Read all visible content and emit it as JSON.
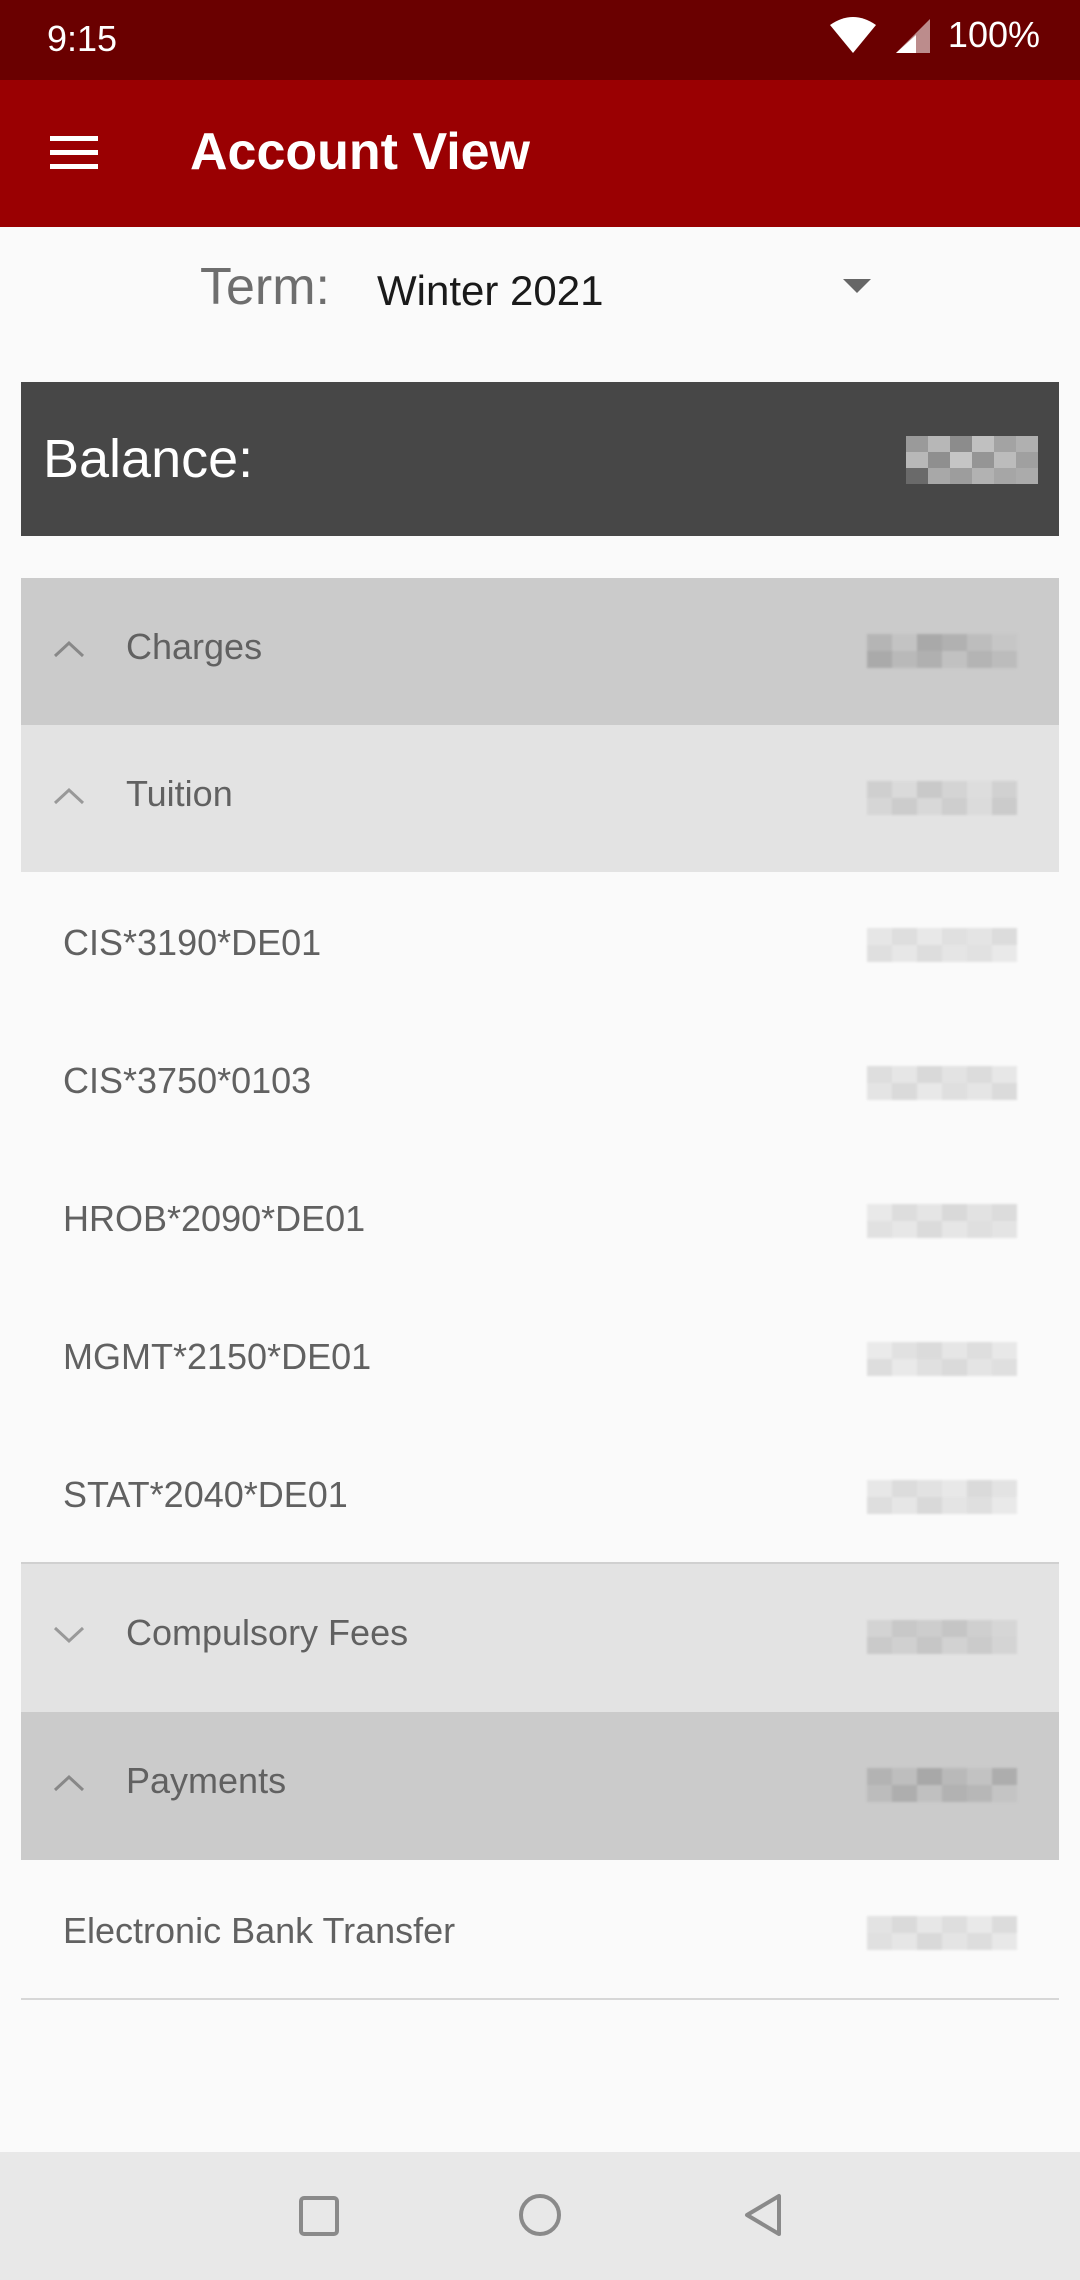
{
  "status_bar": {
    "time": "9:15",
    "battery": "100%"
  },
  "app_bar": {
    "title": "Account View",
    "menu_icon": "hamburger-menu-icon"
  },
  "term": {
    "label": "Term:",
    "value": "Winter 2021"
  },
  "balance": {
    "label": "Balance:"
  },
  "sections": {
    "charges": {
      "label": "Charges"
    },
    "tuition": {
      "label": "Tuition"
    },
    "courses": [
      "CIS*3190*DE01",
      "CIS*3750*0103",
      "HROB*2090*DE01",
      "MGMT*2150*DE01",
      "STAT*2040*DE01"
    ],
    "compulsory_fees": {
      "label": "Compulsory Fees"
    },
    "payments": {
      "label": "Payments"
    },
    "payment_items": [
      "Electronic Bank Transfer"
    ]
  },
  "colors": {
    "status_bar": "#6a0000",
    "app_bar": "#9a0002",
    "balance_bar": "#474747"
  }
}
